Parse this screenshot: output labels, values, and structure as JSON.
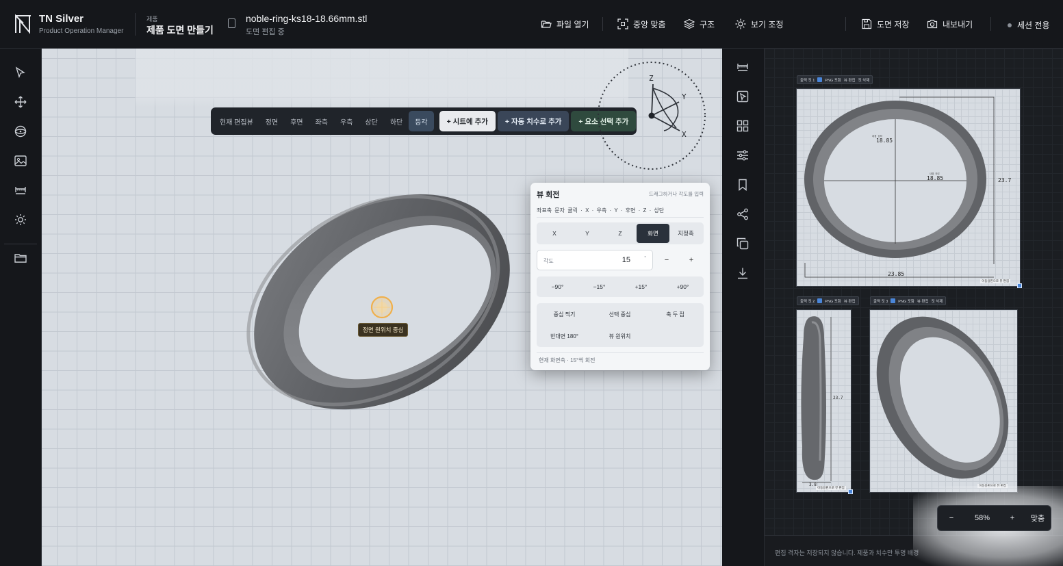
{
  "brand": {
    "name": "TN Silver",
    "subtitle": "Product Operation Manager"
  },
  "breadcrumb": {
    "section": "제품",
    "title": "제품 도면 만들기"
  },
  "file": {
    "name": "noble-ring-ks18-18.66mm.stl",
    "status": "도면 편집 중"
  },
  "toolbar": {
    "open": "파일 열기",
    "center": "중앙 맞춤",
    "structure": "구조",
    "view_adjust": "보기 조정",
    "save": "도면 저장",
    "export": "내보내기",
    "session": "세션 전용"
  },
  "left_tools": [
    "select-icon",
    "move-icon",
    "orbit-icon",
    "image-icon",
    "dimension-icon",
    "light-icon",
    "folder-icon"
  ],
  "view_tabs": {
    "label": "현재 편집뷰",
    "tabs": [
      "정면",
      "후면",
      "좌측",
      "우측",
      "상단",
      "하단",
      "등각"
    ],
    "active": "등각",
    "add_sheet": "+ 시트에 추가",
    "auto_dim": "+ 자동 치수로 추가",
    "add_element": "+ 요소 선택 추가"
  },
  "gizmo": {
    "axes": [
      "Z",
      "Y",
      "X"
    ]
  },
  "center_marker": {
    "label": "정면 원위치 중심"
  },
  "rotation_panel": {
    "title": "뷰 회전",
    "hint": "드래그하거나 각도를 입력",
    "guide": "좌표축 문자 클릭 · X · 우측 · Y · 후면 · Z · 상단",
    "axes": [
      "X",
      "Y",
      "Z",
      "화면",
      "지정축"
    ],
    "active_axis": "화면",
    "angle_label": "각도",
    "angle_value": "15",
    "angle_unit": "°",
    "minus": "−",
    "plus": "+",
    "quick": [
      "−90°",
      "−15°",
      "+15°",
      "+90°"
    ],
    "actions": [
      "중심 찍기",
      "선택 중심",
      "축 두 점",
      "반대면 180°",
      "뷰 원위치"
    ],
    "status": "현재 화면축 · 15°씩 회전"
  },
  "right_tools": [
    "dimension-icon",
    "select-view-icon",
    "grid-icon",
    "sliders-icon",
    "bookmark-icon",
    "share-icon",
    "copy-icon",
    "download-icon"
  ],
  "sheet": {
    "cells": [
      {
        "tag": "출력 컷 1",
        "png": "PNG 포함",
        "edit": "뷰 편집",
        "delete": "컷 삭제",
        "foot": "이동용핀으로 뷰 편집",
        "dims": {
          "inner_label": "내경 상하",
          "inner_v": "18.85",
          "inner_h_label": "내경 좌우",
          "inner_h": "18.85",
          "outer_h": "23.7",
          "outer_w": "23.85"
        }
      },
      {
        "tag": "출력 컷 2",
        "png": "PNG 포함",
        "edit": "뷰 편집",
        "foot": "이동용핀으로 뷰 편집",
        "dims": {
          "height": "23.7",
          "width": "3.8"
        }
      },
      {
        "tag": "출력 컷 3",
        "png": "PNG 포함",
        "edit": "뷰 편집",
        "delete": "컷 삭제",
        "foot": "이동용핀으로 뷰 편집"
      }
    ],
    "zoom": {
      "minus": "−",
      "value": "58%",
      "plus": "+",
      "fit": "맞춤"
    },
    "note": "편집 격자는 저장되지 않습니다. 제품과 치수만 투명 배경"
  }
}
